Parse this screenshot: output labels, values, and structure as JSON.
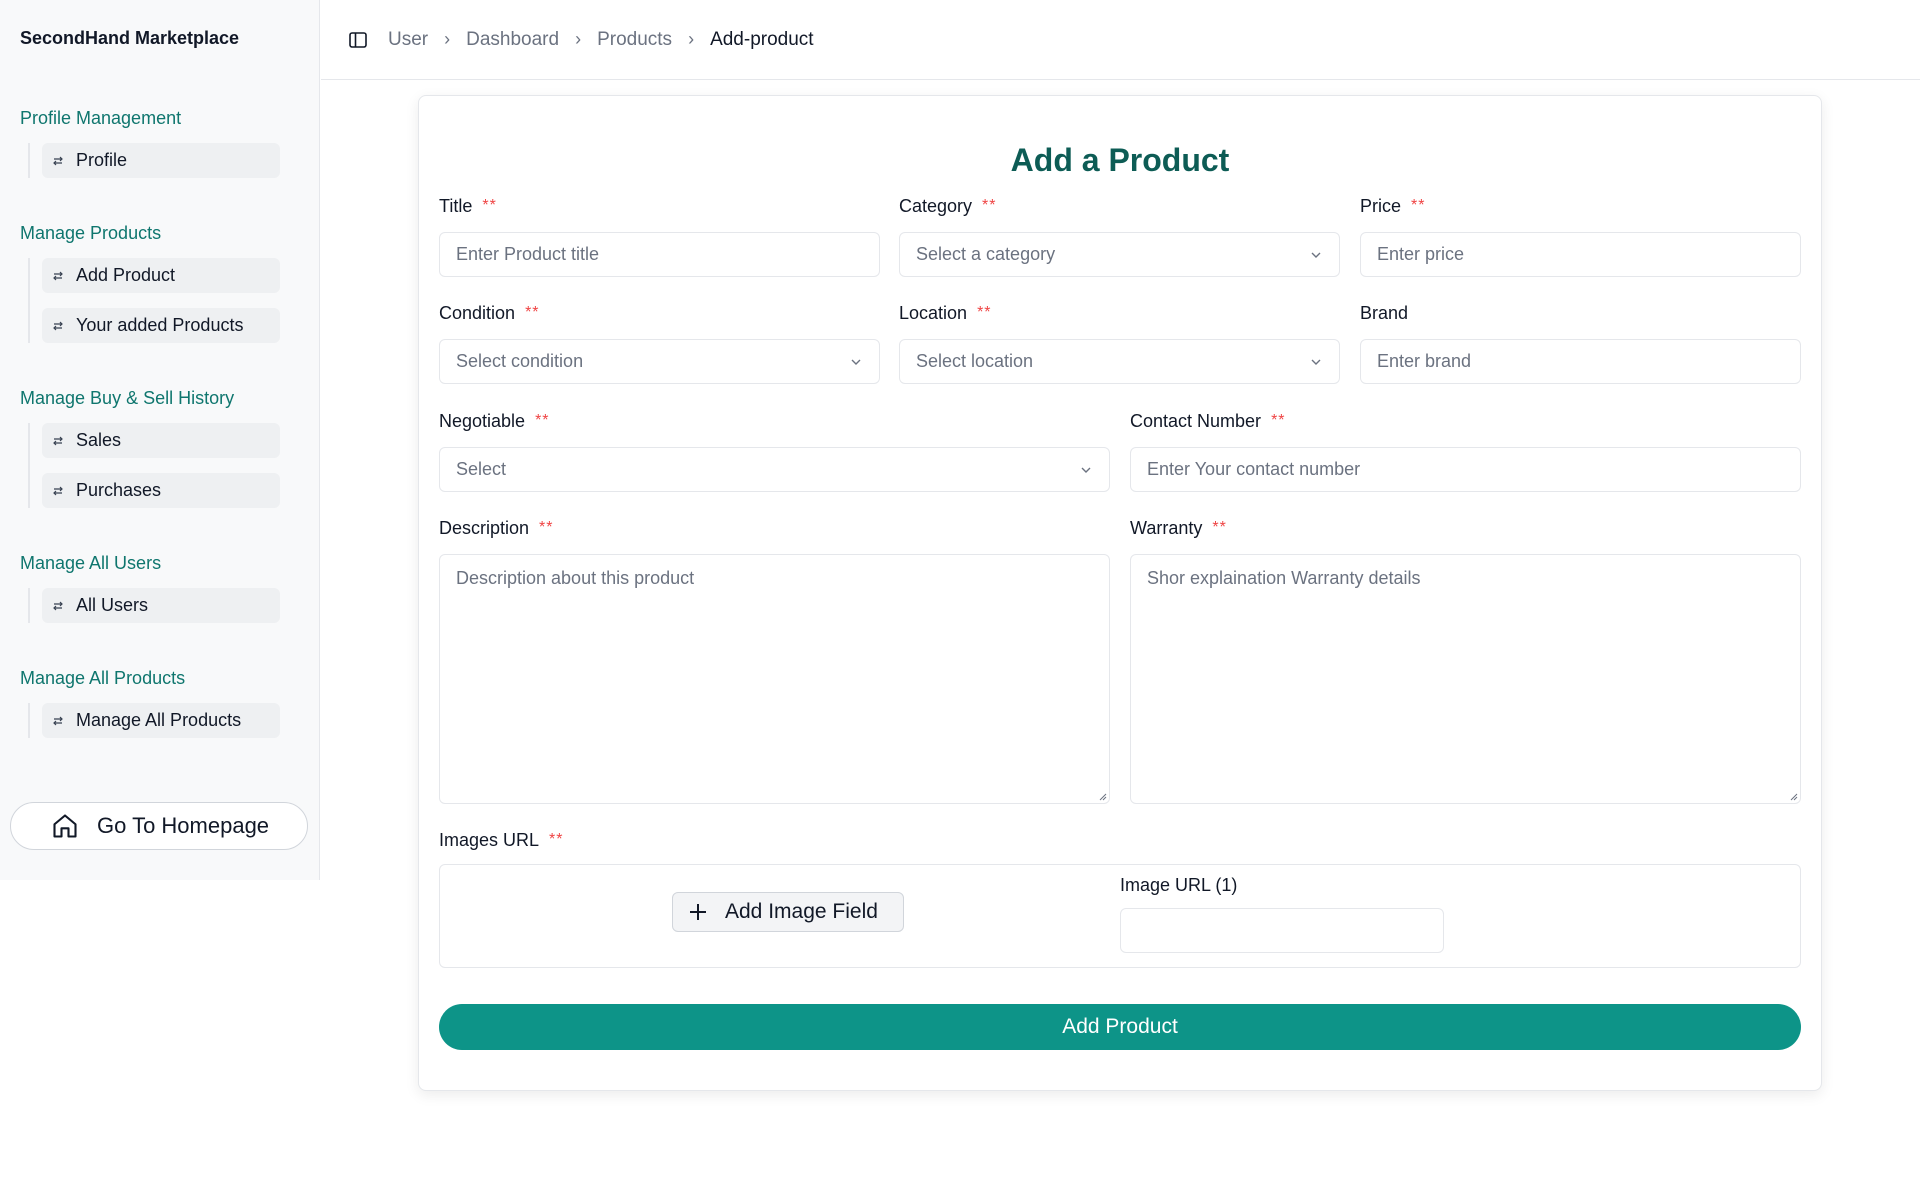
{
  "sidebar": {
    "brand": "SecondHand Marketplace",
    "groups": [
      {
        "title": "Profile Management",
        "items": [
          {
            "label": "Profile"
          }
        ]
      },
      {
        "title": "Manage Products",
        "items": [
          {
            "label": "Add Product"
          },
          {
            "label": "Your added Products"
          }
        ]
      },
      {
        "title": "Manage Buy & Sell History",
        "items": [
          {
            "label": "Sales"
          },
          {
            "label": "Purchases"
          }
        ]
      },
      {
        "title": "Manage All Users",
        "items": [
          {
            "label": "All Users"
          }
        ]
      },
      {
        "title": "Manage All Products",
        "items": [
          {
            "label": "Manage All Products"
          }
        ]
      }
    ],
    "home_button": "Go To Homepage"
  },
  "breadcrumb": [
    "User",
    "Dashboard",
    "Products",
    "Add-product"
  ],
  "form": {
    "title": "Add a Product",
    "required_mark": "**",
    "fields": {
      "title": {
        "label": "Title",
        "placeholder": "Enter Product title"
      },
      "category": {
        "label": "Category",
        "placeholder": "Select a category"
      },
      "price": {
        "label": "Price",
        "placeholder": "Enter price"
      },
      "condition": {
        "label": "Condition",
        "placeholder": "Select condition"
      },
      "location": {
        "label": "Location",
        "placeholder": "Select location"
      },
      "brand": {
        "label": "Brand",
        "placeholder": "Enter brand"
      },
      "negotiable": {
        "label": "Negotiable",
        "placeholder": "Select"
      },
      "contact": {
        "label": "Contact Number",
        "placeholder": "Enter Your contact number"
      },
      "description": {
        "label": "Description",
        "placeholder": "Description about this product"
      },
      "warranty": {
        "label": "Warranty",
        "placeholder": "Shor explaination Warranty details"
      }
    },
    "images": {
      "label": "Images URL",
      "add_button": "Add Image Field",
      "url_label": "Image URL (1)",
      "url_value": ""
    },
    "submit_label": "Add Product"
  },
  "colors": {
    "accent": "#0d9488",
    "heading": "#0d5c55",
    "sidebar_title": "#0f766e",
    "required": "#ef4444"
  }
}
